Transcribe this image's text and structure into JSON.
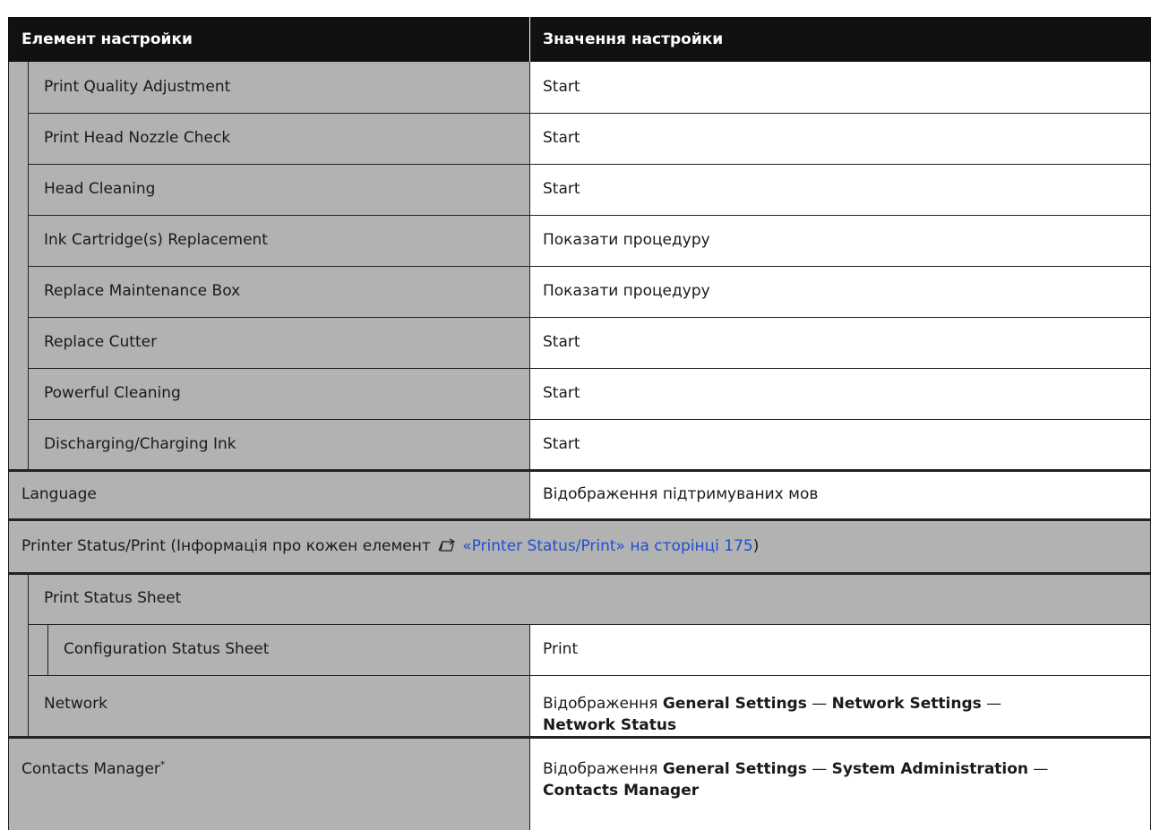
{
  "header": {
    "col1": "Елемент настройки",
    "col2": "Значення настройки"
  },
  "rows": [
    {
      "item": "Print Quality Adjustment",
      "value": "Start"
    },
    {
      "item": "Print Head Nozzle Check",
      "value": "Start"
    },
    {
      "item": "Head Cleaning",
      "value": "Start"
    },
    {
      "item": "Ink Cartridge(s) Replacement",
      "value": "Показати процедуру"
    },
    {
      "item": "Replace Maintenance Box",
      "value": "Показати процедуру"
    },
    {
      "item": "Replace Cutter",
      "value": "Start"
    },
    {
      "item": "Powerful Cleaning",
      "value": "Start"
    },
    {
      "item": "Discharging/Charging Ink",
      "value": "Start"
    }
  ],
  "language": {
    "item": "Language",
    "value": "Відображення підтримуваних мов"
  },
  "printer_status": {
    "prefix": "Printer Status/Print (Інформація про кожен елемент ",
    "icon": "reference-arrow-icon",
    "link_text": "«Printer Status/Print» на сторінці 175",
    "suffix": ")"
  },
  "print_status_sheet": "Print Status Sheet",
  "config_sheet": {
    "item": "Configuration Status Sheet",
    "value": "Print"
  },
  "network": {
    "item": "Network",
    "v_prefix": "Відображення ",
    "b1": "General Settings",
    "dash1": " — ",
    "b2": "Network Settings",
    "dash2": " —",
    "b3": "Network Status"
  },
  "contacts": {
    "item": "Contacts Manager",
    "sup": "*",
    "v_prefix": "Відображення ",
    "b1": "General Settings",
    "dash1": " — ",
    "b2": "System Administration",
    "dash2": " —",
    "b3": "Contacts Manager"
  },
  "colors": {
    "header_bg": "#111111",
    "cell_gray": "#b2b2b2",
    "link": "#1f4fcf"
  }
}
